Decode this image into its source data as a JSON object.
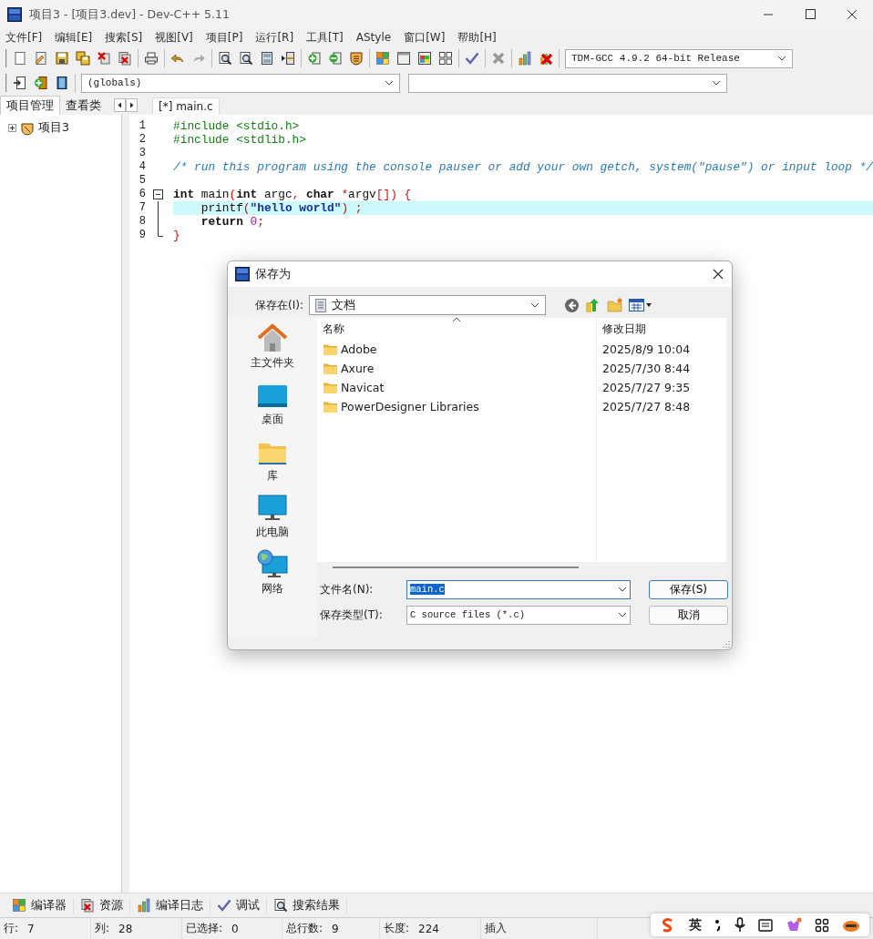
{
  "window": {
    "title": "项目3 - [项目3.dev] - Dev-C++ 5.11"
  },
  "menu": [
    "文件[F]",
    "编辑[E]",
    "搜索[S]",
    "视图[V]",
    "项目[P]",
    "运行[R]",
    "工具[T]",
    "AStyle",
    "窗口[W]",
    "帮助[H]"
  ],
  "toolbar": {
    "compiler_select": "TDM-GCC 4.9.2 64-bit Release",
    "scope_select": "(globals)"
  },
  "left_panel": {
    "tabs": [
      {
        "label": "项目管理",
        "selected": true
      },
      {
        "label": "查看类",
        "selected": false
      }
    ],
    "tree": [
      {
        "label": "项目3",
        "expanded": false
      }
    ]
  },
  "editor": {
    "tabs": [
      {
        "label": "[*] main.c",
        "selected": true
      }
    ],
    "lines": [
      {
        "number": "1",
        "foldable": false,
        "in_block": false,
        "highlighted": false,
        "segments": [
          {
            "text": "#include <stdio.h>",
            "kind": "preproc"
          }
        ]
      },
      {
        "number": "2",
        "foldable": false,
        "in_block": false,
        "highlighted": false,
        "segments": [
          {
            "text": "#include <stdlib.h>",
            "kind": "preproc"
          }
        ]
      },
      {
        "number": "3",
        "foldable": false,
        "in_block": false,
        "highlighted": false
      },
      {
        "number": "4",
        "foldable": false,
        "in_block": false,
        "highlighted": false,
        "segments": [
          {
            "text": "/* run this program using the console pauser or add your own getch, system(\"pause\") or input loop */",
            "kind": "comment"
          }
        ]
      },
      {
        "number": "5",
        "foldable": false,
        "in_block": false,
        "highlighted": false
      },
      {
        "number": "6",
        "foldable": true,
        "in_block": false,
        "highlighted": false,
        "segments": [
          {
            "text": "int",
            "kind": "keyword"
          },
          {
            "text": " main",
            "kind": "plain"
          },
          {
            "text": "(",
            "kind": "symbol"
          },
          {
            "text": "int",
            "kind": "keyword"
          },
          {
            "text": " argc",
            "kind": "plain"
          },
          {
            "text": ", ",
            "kind": "symbol"
          },
          {
            "text": "char",
            "kind": "keyword"
          },
          {
            "text": " *",
            "kind": "symbol"
          },
          {
            "text": "argv",
            "kind": "plain"
          },
          {
            "text": "[])",
            "kind": "symbol"
          },
          {
            "text": " {",
            "kind": "symbol"
          }
        ]
      },
      {
        "number": "7",
        "foldable": false,
        "in_block": true,
        "highlighted": true,
        "segments": [
          {
            "text": "    printf",
            "kind": "plain"
          },
          {
            "text": "(",
            "kind": "symbol"
          },
          {
            "text": "\"hello world\"",
            "kind": "string"
          },
          {
            "text": ")",
            "kind": "symbol"
          },
          {
            "text": " ;",
            "kind": "symbol"
          }
        ]
      },
      {
        "number": "8",
        "foldable": false,
        "in_block": true,
        "highlighted": false,
        "segments": [
          {
            "text": "    return",
            "kind": "keyword"
          },
          {
            "text": " 0",
            "kind": "number"
          },
          {
            "text": ";",
            "kind": "symbol"
          }
        ]
      },
      {
        "number": "9",
        "foldable": false,
        "in_block": true,
        "highlighted": false,
        "segments": [
          {
            "text": "}",
            "kind": "symbol"
          }
        ]
      }
    ]
  },
  "dialog": {
    "title": "保存为",
    "location_label": "保存在(I):",
    "location": "文档",
    "places": [
      {
        "label": "主文件夹",
        "kind": "home"
      },
      {
        "label": "桌面",
        "kind": "desktop"
      },
      {
        "label": "库",
        "kind": "library"
      },
      {
        "label": "此电脑",
        "kind": "computer"
      },
      {
        "label": "网络",
        "kind": "network"
      }
    ],
    "columns": [
      "名称",
      "修改日期"
    ],
    "files": [
      {
        "name": "Adobe",
        "modified": "2025/8/9 10:04"
      },
      {
        "name": "Axure",
        "modified": "2025/7/30 8:44"
      },
      {
        "name": "Navicat",
        "modified": "2025/7/27 9:35"
      },
      {
        "name": "PowerDesigner Libraries",
        "modified": "2025/7/27 8:48"
      }
    ],
    "filename_label": "文件名(N):",
    "filename": "main.c",
    "filename_selected": true,
    "filetype_label": "保存类型(T):",
    "filetype": "C source files (*.c)",
    "buttons": [
      {
        "label": "保存(S)",
        "default": true
      },
      {
        "label": "取消",
        "default": false
      }
    ]
  },
  "bottom_tabs": [
    {
      "label": "编译器",
      "kind": "compiler"
    },
    {
      "label": "资源",
      "kind": "resources"
    },
    {
      "label": "编译日志",
      "kind": "log"
    },
    {
      "label": "调试",
      "kind": "debug"
    },
    {
      "label": "搜索结果",
      "kind": "search"
    }
  ],
  "status_bar": [
    {
      "label": "行:",
      "value": "7"
    },
    {
      "label": "列:",
      "value": "28"
    },
    {
      "label": "已选择:",
      "value": "0"
    },
    {
      "label": "总行数:",
      "value": "9"
    },
    {
      "label": "长度:",
      "value": "224"
    }
  ],
  "edit_mode": "插入",
  "ime_bar": {
    "language": "英"
  }
}
